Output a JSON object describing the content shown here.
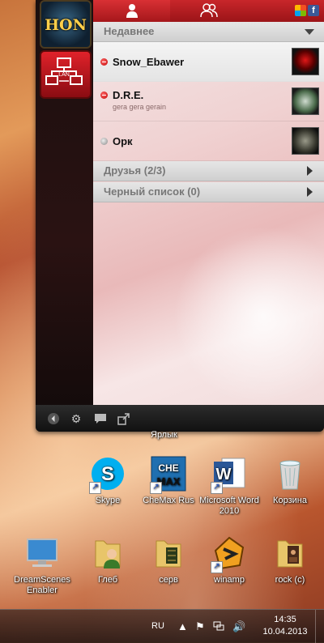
{
  "messenger": {
    "tabs": [
      {
        "icon": "user-icon"
      },
      {
        "icon": "users-icon"
      }
    ],
    "social": [
      {
        "icon": "windows-live-icon"
      },
      {
        "icon": "facebook-icon",
        "label": "f"
      }
    ],
    "sections": {
      "recent": "Недавнее",
      "friends": "Друзья (2/3)",
      "blacklist": "Черный список (0)"
    },
    "contacts": [
      {
        "name": "Snow_Ebawer",
        "status": "",
        "presence": "busy"
      },
      {
        "name": "D.R.E.",
        "status": "gera gera gerain",
        "presence": "busy"
      },
      {
        "name": "Орк",
        "status": "",
        "presence": "offline"
      }
    ],
    "apps": [
      {
        "label": "HON"
      },
      {
        "label": "LAN"
      }
    ],
    "accent": "#c8262a"
  },
  "desktop": {
    "partial_label": "Ярлык",
    "icons": [
      {
        "label": "Skype"
      },
      {
        "label": "CheMax Rus",
        "art": "CHE MAX"
      },
      {
        "label": "Microsoft Word 2010",
        "art": "W"
      },
      {
        "label": "Корзина"
      },
      {
        "label": "DreamScenes Enabler"
      },
      {
        "label": "Глеб"
      },
      {
        "label": "серв"
      },
      {
        "label": "winamp"
      },
      {
        "label": "rock (c)"
      }
    ]
  },
  "taskbar": {
    "lang": "RU",
    "time": "14:35",
    "date": "10.04.2013"
  }
}
